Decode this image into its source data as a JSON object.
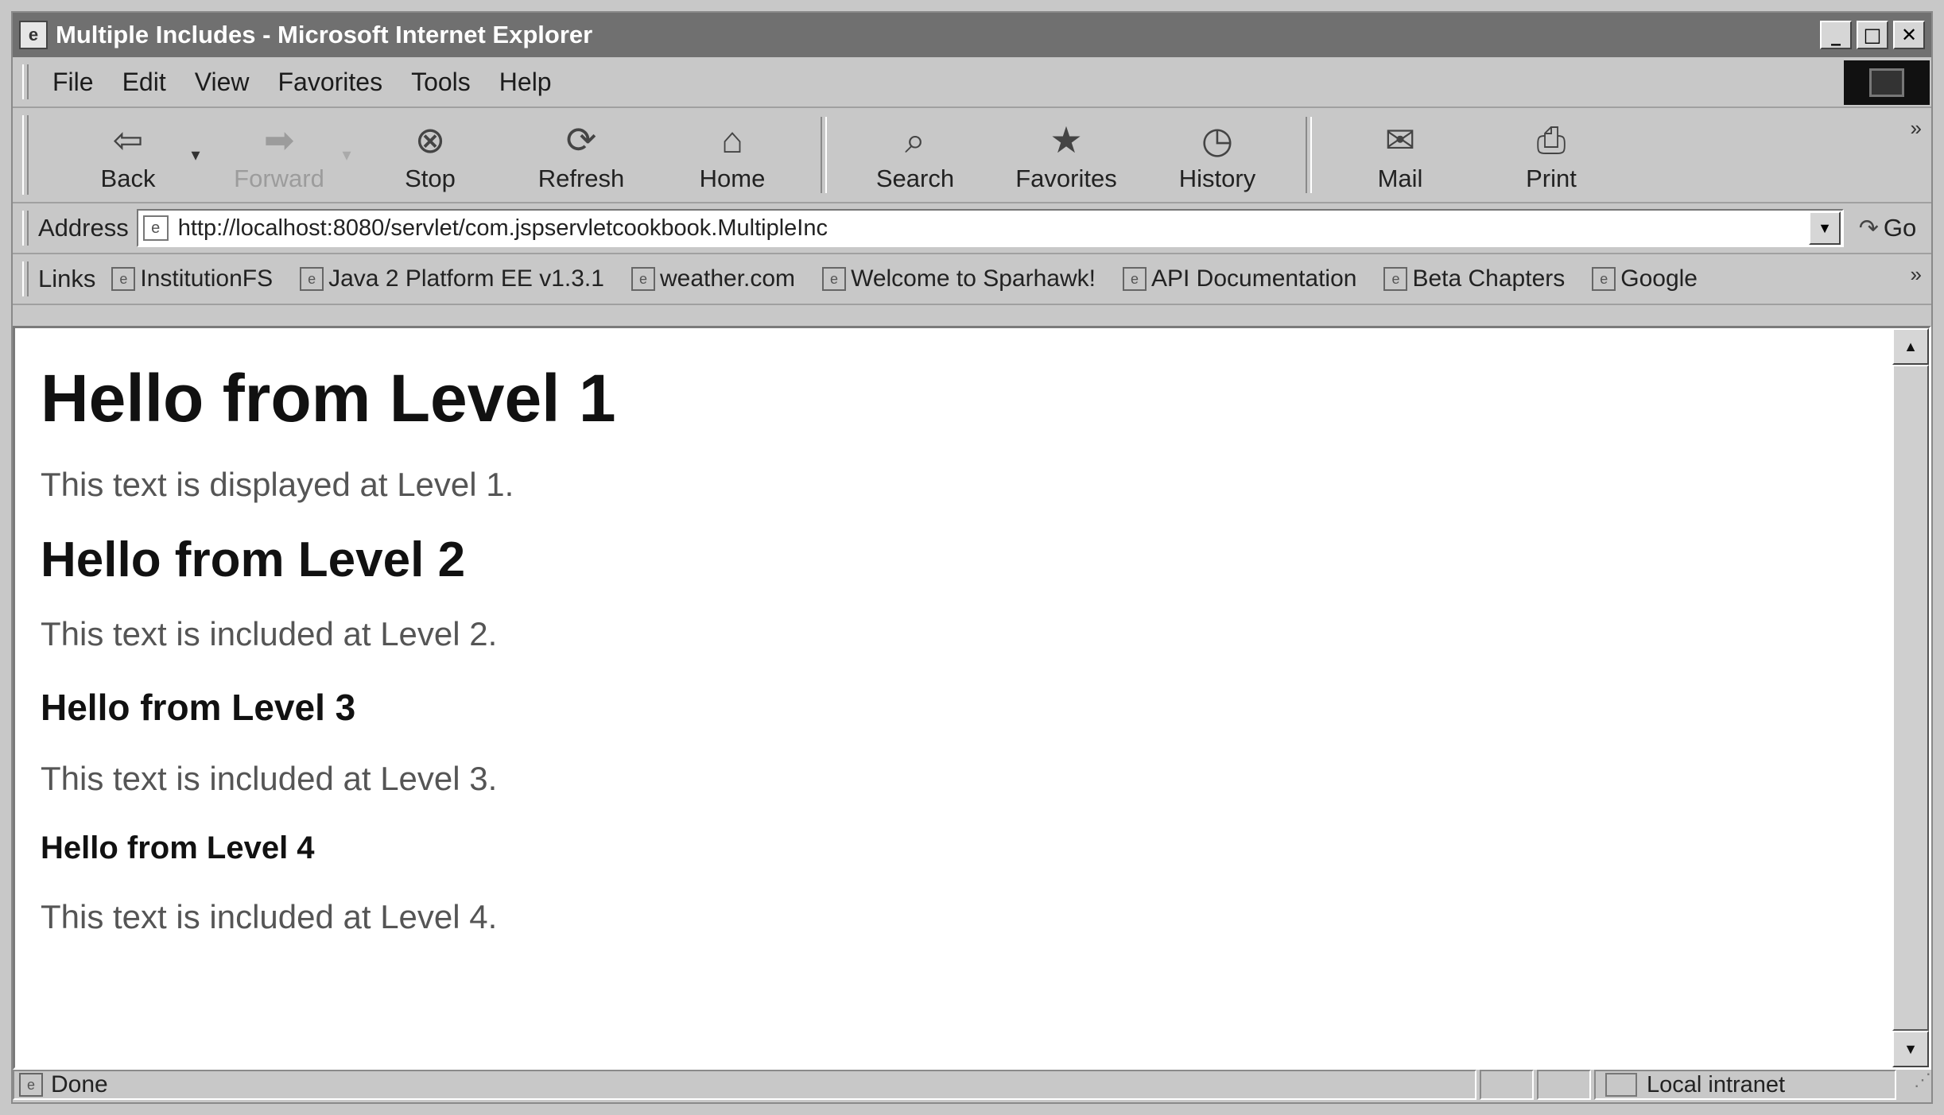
{
  "window": {
    "title": "Multiple Includes - Microsoft Internet Explorer",
    "minimize": "_",
    "maximize": "□",
    "close": "✕"
  },
  "menu": {
    "items": [
      {
        "label": "File"
      },
      {
        "label": "Edit"
      },
      {
        "label": "View"
      },
      {
        "label": "Favorites"
      },
      {
        "label": "Tools"
      },
      {
        "label": "Help"
      }
    ]
  },
  "toolbar": {
    "back": {
      "label": "Back",
      "icon": "back-arrow-icon",
      "glyph": "⇦"
    },
    "forward": {
      "label": "Forward",
      "icon": "forward-arrow-icon",
      "glyph": "➡"
    },
    "stop": {
      "label": "Stop",
      "icon": "stop-icon",
      "glyph": "⊗"
    },
    "refresh": {
      "label": "Refresh",
      "icon": "refresh-icon",
      "glyph": "⟳"
    },
    "home": {
      "label": "Home",
      "icon": "home-icon",
      "glyph": "⌂"
    },
    "search": {
      "label": "Search",
      "icon": "search-icon",
      "glyph": "⌕"
    },
    "favorites": {
      "label": "Favorites",
      "icon": "favorites-icon",
      "glyph": "★"
    },
    "history": {
      "label": "History",
      "icon": "history-icon",
      "glyph": "◷"
    },
    "mail": {
      "label": "Mail",
      "icon": "mail-icon",
      "glyph": "✉"
    },
    "print": {
      "label": "Print",
      "icon": "print-icon",
      "glyph": "⎙"
    },
    "dropdown_glyph": "▾",
    "more_glyph": "»"
  },
  "address": {
    "label": "Address",
    "url": "http://localhost:8080/servlet/com.jspservletcookbook.MultipleInc",
    "dropdown_glyph": "▼",
    "go_label": "Go",
    "go_glyph": "↷"
  },
  "links": {
    "label": "Links",
    "items": [
      {
        "label": "InstitutionFS"
      },
      {
        "label": "Java 2 Platform EE v1.3.1"
      },
      {
        "label": "weather.com"
      },
      {
        "label": "Welcome to Sparhawk!"
      },
      {
        "label": "API Documentation"
      },
      {
        "label": "Beta Chapters"
      },
      {
        "label": "Google"
      }
    ],
    "more_glyph": "»"
  },
  "page": {
    "h1": "Hello from Level 1",
    "p1": "This text is displayed at Level 1.",
    "h2": "Hello from Level 2",
    "p2": "This text is included at Level 2.",
    "h3": "Hello from Level 3",
    "p3": "This text is included at Level 3.",
    "h4": "Hello from Level 4",
    "p4": "This text is included at Level 4."
  },
  "scrollbar": {
    "up_glyph": "▲",
    "down_glyph": "▼"
  },
  "status": {
    "text": "Done",
    "zone": "Local intranet",
    "grip_glyph": "⋰"
  }
}
